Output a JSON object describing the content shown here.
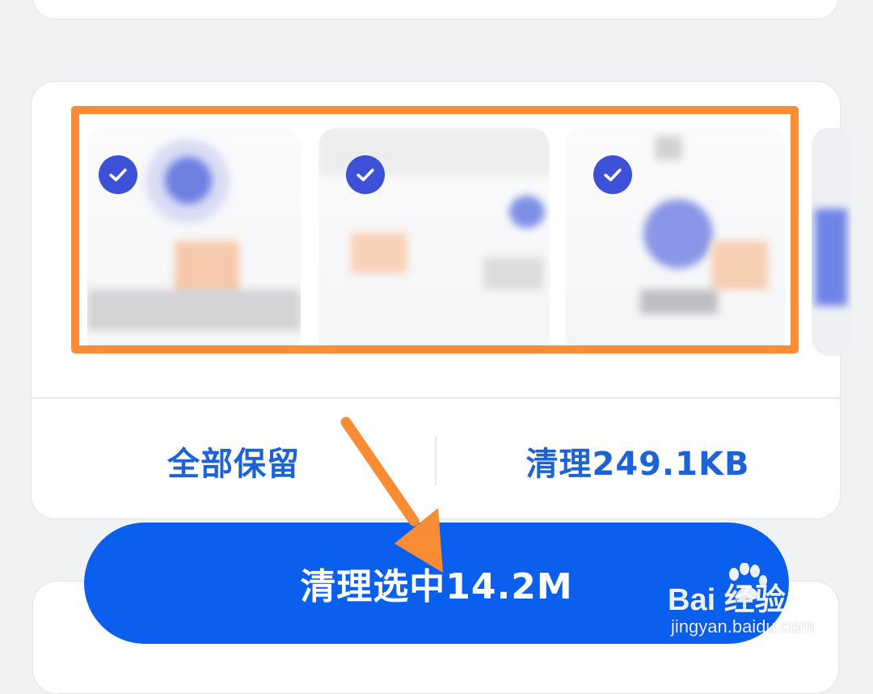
{
  "actions": {
    "keep_all": "全部保留",
    "clean": "清理249.1KB"
  },
  "primary_button": {
    "label": "清理选中14.2M"
  },
  "watermark": {
    "brand": "Bai  经验",
    "url": "jingyan.baidu.com"
  },
  "icons": {
    "check": "check-circle-icon",
    "app": "app-logo-icon"
  },
  "colors": {
    "accent": "#1d63d6",
    "button": "#0b5fee",
    "check": "#3d50d8",
    "annotation": "#f98c34"
  }
}
